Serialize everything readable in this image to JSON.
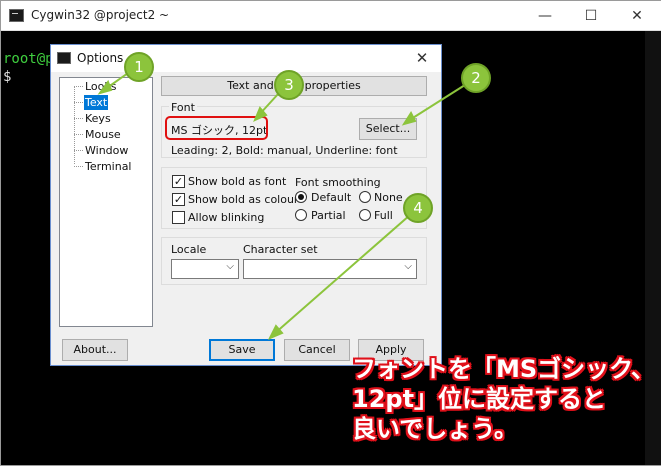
{
  "terminal": {
    "title": "Cygwin32 @project2 ~",
    "prompt_line1": "root@p",
    "prompt_line2": "$ ",
    "min_glyph": "—",
    "max_glyph": "☐",
    "close_glyph": "✕"
  },
  "dialog": {
    "title": "Options",
    "close_glyph": "✕",
    "tree": {
      "items": [
        {
          "label": "Looks",
          "selected": false
        },
        {
          "label": "Text",
          "selected": true
        },
        {
          "label": "Keys",
          "selected": false
        },
        {
          "label": "Mouse",
          "selected": false
        },
        {
          "label": "Window",
          "selected": false
        },
        {
          "label": "Terminal",
          "selected": false
        }
      ]
    },
    "header_button": "Text and Font properties",
    "font": {
      "group_label": "Font",
      "value": "MS ゴシック, 12pt",
      "select_button": "Select...",
      "info": "Leading: 2, Bold: manual, Underline: font"
    },
    "options": {
      "show_bold_as_font": {
        "label": "Show bold as font",
        "checked": true
      },
      "show_bold_as_colour": {
        "label": "Show bold as colour",
        "checked": true
      },
      "allow_blinking": {
        "label": "Allow blinking",
        "checked": false
      },
      "smoothing_label": "Font smoothing",
      "smoothing": [
        {
          "label": "Default",
          "selected": true
        },
        {
          "label": "None",
          "selected": false
        },
        {
          "label": "Partial",
          "selected": false
        },
        {
          "label": "Full",
          "selected": false
        }
      ]
    },
    "locale": {
      "label": "Locale",
      "value": ""
    },
    "charset": {
      "label": "Character set",
      "value": ""
    },
    "buttons": {
      "about": "About...",
      "save": "Save",
      "cancel": "Cancel",
      "apply": "Apply"
    }
  },
  "annotations": {
    "badges": [
      "1",
      "2",
      "3",
      "4"
    ],
    "caption": "フォントを「MSゴシック、\n12pt」位に設定すると\n良いでしょう。",
    "colors": {
      "badge": "#8cc43c",
      "highlight": "#e01010",
      "caption_outline": "#e0101a"
    }
  }
}
